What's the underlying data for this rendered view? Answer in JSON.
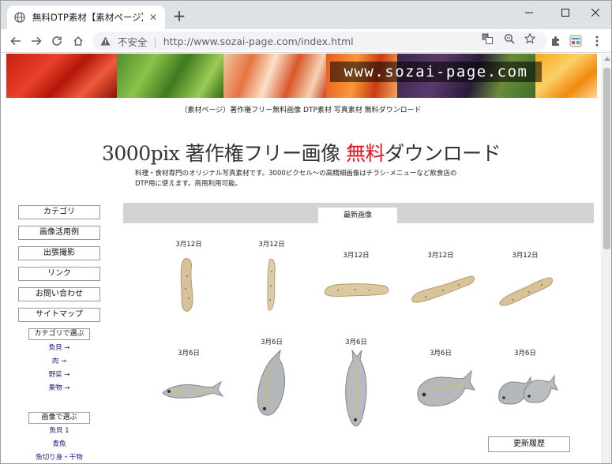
{
  "browser": {
    "tab_title": "無料DTP素材【素材ページ】食",
    "new_tab_label": "+",
    "security_label": "不安全",
    "url": "http://www.sozai-page.com/index.html"
  },
  "page": {
    "banner_logo": "www.sozai-page.com",
    "subline": "（素材ページ）著作権フリー無料画像 DTP素材 写真素材 無料ダウンロード",
    "headline": {
      "part1": "3000pix 著作権フリー画像 ",
      "highlight": "無料",
      "part2": "ダウンロード"
    },
    "intro_line1": "料理・食材専門のオリジナル写真素材です。3000ピクセル～の高精細画像はチラシ･メニューなど飲食店の",
    "intro_line2": "DTP用に使えます。商用利用可能。",
    "colors": {
      "headline_accent": "#e0141e",
      "link": "#1a1a8c",
      "section_bar": "#d3d3d3"
    }
  },
  "sidebar": {
    "buttons": [
      "カテゴリ",
      "画像活用例",
      "出張撮影",
      "リンク",
      "お問い合わせ",
      "サイトマップ"
    ],
    "category_label": "カテゴリで選ぶ",
    "category_links": [
      "魚貝 →",
      "肉 →",
      "野菜 →",
      "果物 →"
    ],
    "image_label": "画像で選ぶ",
    "image_links": [
      "魚貝 1",
      "青魚",
      "魚切り身・干物"
    ]
  },
  "latest": {
    "tab_label": "最新画像",
    "row1_dates": [
      "3月12日",
      "3月12日",
      "3月12日",
      "3月12日",
      "3月12日"
    ],
    "row2_dates": [
      "3月6日",
      "3月6日",
      "3月6日",
      "3月6日",
      "3月6日"
    ],
    "row1_icons": [
      "yam-root-icon",
      "yam-root-icon",
      "yam-root-icon",
      "yam-root-icon",
      "yam-root-icon"
    ],
    "row2_icons": [
      "fish-icon",
      "fish-icon",
      "fish-icon",
      "fish-icon",
      "fish-pair-icon"
    ],
    "history_button": "更新履歴"
  }
}
